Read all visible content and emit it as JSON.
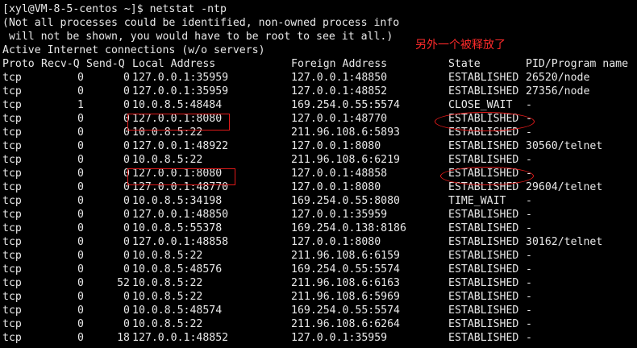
{
  "terminal": {
    "prompt_line": "[xyl@VM-8-5-centos ~]$ netstat -ntp",
    "notice_line_1": "(Not all processes could be identified, non-owned process info",
    "notice_line_2": " will not be shown, you would have to be root to see it all.)",
    "section_title": "Active Internet connections (w/o servers)",
    "headers": {
      "proto": "Proto",
      "recvq": "Recv-Q",
      "sendq": "Send-Q",
      "local": "Local Address",
      "foreign": "Foreign Address",
      "state": "State",
      "pid": "PID/Program name"
    },
    "rows": [
      {
        "proto": "tcp",
        "recvq": "0",
        "sendq": "0",
        "local": "127.0.0.1:35959",
        "foreign": "127.0.0.1:48850",
        "state": "ESTABLISHED",
        "pid": "26520/node"
      },
      {
        "proto": "tcp",
        "recvq": "0",
        "sendq": "0",
        "local": "127.0.0.1:35959",
        "foreign": "127.0.0.1:48852",
        "state": "ESTABLISHED",
        "pid": "27356/node"
      },
      {
        "proto": "tcp",
        "recvq": "1",
        "sendq": "0",
        "local": "10.0.8.5:48484",
        "foreign": "169.254.0.55:5574",
        "state": "CLOSE_WAIT",
        "pid": "-"
      },
      {
        "proto": "tcp",
        "recvq": "0",
        "sendq": "0",
        "local": "127.0.0.1:8080",
        "foreign": "127.0.0.1:48770",
        "state": "ESTABLISHED",
        "pid": "-"
      },
      {
        "proto": "tcp",
        "recvq": "0",
        "sendq": "0",
        "local": "10.0.8.5:22",
        "foreign": "211.96.108.6:5893",
        "state": "ESTABLISHED",
        "pid": "-"
      },
      {
        "proto": "tcp",
        "recvq": "0",
        "sendq": "0",
        "local": "127.0.0.1:48922",
        "foreign": "127.0.0.1:8080",
        "state": "ESTABLISHED",
        "pid": "30560/telnet"
      },
      {
        "proto": "tcp",
        "recvq": "0",
        "sendq": "0",
        "local": "10.0.8.5:22",
        "foreign": "211.96.108.6:6219",
        "state": "ESTABLISHED",
        "pid": "-"
      },
      {
        "proto": "tcp",
        "recvq": "0",
        "sendq": "0",
        "local": "127.0.0.1:8080",
        "foreign": "127.0.0.1:48858",
        "state": "ESTABLISHED",
        "pid": "-"
      },
      {
        "proto": "tcp",
        "recvq": "0",
        "sendq": "0",
        "local": "127.0.0.1:48770",
        "foreign": "127.0.0.1:8080",
        "state": "ESTABLISHED",
        "pid": "29604/telnet"
      },
      {
        "proto": "tcp",
        "recvq": "0",
        "sendq": "0",
        "local": "10.0.8.5:34198",
        "foreign": "169.254.0.55:8080",
        "state": "TIME_WAIT",
        "pid": "-"
      },
      {
        "proto": "tcp",
        "recvq": "0",
        "sendq": "0",
        "local": "127.0.0.1:48850",
        "foreign": "127.0.0.1:35959",
        "state": "ESTABLISHED",
        "pid": "-"
      },
      {
        "proto": "tcp",
        "recvq": "0",
        "sendq": "0",
        "local": "10.0.8.5:55378",
        "foreign": "169.254.0.138:8186",
        "state": "ESTABLISHED",
        "pid": "-"
      },
      {
        "proto": "tcp",
        "recvq": "0",
        "sendq": "0",
        "local": "127.0.0.1:48858",
        "foreign": "127.0.0.1:8080",
        "state": "ESTABLISHED",
        "pid": "30162/telnet"
      },
      {
        "proto": "tcp",
        "recvq": "0",
        "sendq": "0",
        "local": "10.0.8.5:22",
        "foreign": "211.96.108.6:6159",
        "state": "ESTABLISHED",
        "pid": "-"
      },
      {
        "proto": "tcp",
        "recvq": "0",
        "sendq": "0",
        "local": "10.0.8.5:48576",
        "foreign": "169.254.0.55:5574",
        "state": "ESTABLISHED",
        "pid": "-"
      },
      {
        "proto": "tcp",
        "recvq": "0",
        "sendq": "52",
        "local": "10.0.8.5:22",
        "foreign": "211.96.108.6:6163",
        "state": "ESTABLISHED",
        "pid": "-"
      },
      {
        "proto": "tcp",
        "recvq": "0",
        "sendq": "0",
        "local": "10.0.8.5:22",
        "foreign": "211.96.108.6:5969",
        "state": "ESTABLISHED",
        "pid": "-"
      },
      {
        "proto": "tcp",
        "recvq": "0",
        "sendq": "0",
        "local": "10.0.8.5:48574",
        "foreign": "169.254.0.55:5574",
        "state": "ESTABLISHED",
        "pid": "-"
      },
      {
        "proto": "tcp",
        "recvq": "0",
        "sendq": "0",
        "local": "10.0.8.5:22",
        "foreign": "211.96.108.6:6264",
        "state": "ESTABLISHED",
        "pid": "-"
      },
      {
        "proto": "tcp",
        "recvq": "0",
        "sendq": "18",
        "local": "127.0.0.1:48852",
        "foreign": "127.0.0.1:35959",
        "state": "ESTABLISHED",
        "pid": "-"
      }
    ]
  },
  "annotation": {
    "note": "另外一个被释放了",
    "color": "#e11a1a"
  }
}
